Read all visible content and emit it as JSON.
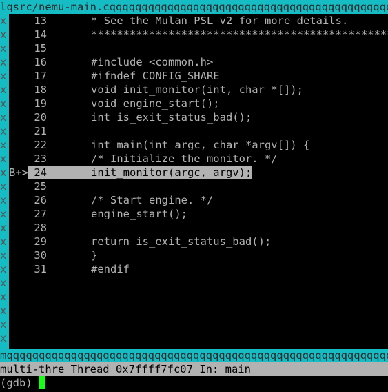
{
  "window": {
    "title_bar_text": "lqsrc/nemu-main.cqqqqqqqqqqqqqqqqqqqqqqqqqqqqqqqqqqqqqqqqqqqqqqqqqqqqqqqqqqq",
    "bottom_border_text": "mqqqqqqqqqqqqqqqqqqqqqqqqqqqqqqqqqqqqqqqqqqqqqqqqqqqqqqqqqqqqqqqqqqqqqqqq",
    "left_border_char": "x",
    "source_file": "src/nemu-main.c",
    "border_color": "#16bcc4",
    "highlight_color": "#b2b2b2",
    "background_color": "#000000",
    "text_color": "#b2b2b2",
    "cursor_color": "#16ff16"
  },
  "source": {
    "rows": [
      {
        "marker": "",
        "lineno": "13",
        "text": "* See the Mulan PSL v2 for more details.",
        "indent": 4,
        "current": false
      },
      {
        "marker": "",
        "lineno": "14",
        "text": "***************************************************",
        "indent": 4,
        "current": false
      },
      {
        "marker": "",
        "lineno": "15",
        "text": "",
        "indent": 0,
        "current": false
      },
      {
        "marker": "",
        "lineno": "16",
        "text": "#include <common.h>",
        "indent": 3,
        "current": false
      },
      {
        "marker": "",
        "lineno": "17",
        "text": "#ifndef CONFIG_SHARE",
        "indent": 3,
        "current": false
      },
      {
        "marker": "",
        "lineno": "18",
        "text": "void init_monitor(int, char *[]);",
        "indent": 3,
        "current": false
      },
      {
        "marker": "",
        "lineno": "19",
        "text": "void engine_start();",
        "indent": 3,
        "current": false
      },
      {
        "marker": "",
        "lineno": "20",
        "text": "int is_exit_status_bad();",
        "indent": 3,
        "current": false
      },
      {
        "marker": "",
        "lineno": "21",
        "text": "",
        "indent": 0,
        "current": false
      },
      {
        "marker": "",
        "lineno": "22",
        "text": "int main(int argc, char *argv[]) {",
        "indent": 3,
        "current": false
      },
      {
        "marker": "",
        "lineno": "23",
        "text": "/* Initialize the monitor. */",
        "indent": 4,
        "current": false
      },
      {
        "marker": "B+>",
        "lineno": "24",
        "text": "init_monitor(argc, argv);",
        "indent": 4,
        "current": true
      },
      {
        "marker": "",
        "lineno": "25",
        "text": "",
        "indent": 0,
        "current": false
      },
      {
        "marker": "",
        "lineno": "26",
        "text": "/* Start engine. */",
        "indent": 4,
        "current": false
      },
      {
        "marker": "",
        "lineno": "27",
        "text": "engine_start();",
        "indent": 4,
        "current": false
      },
      {
        "marker": "",
        "lineno": "28",
        "text": "",
        "indent": 0,
        "current": false
      },
      {
        "marker": "",
        "lineno": "29",
        "text": "return is_exit_status_bad();",
        "indent": 4,
        "current": false
      },
      {
        "marker": "",
        "lineno": "30",
        "text": "}",
        "indent": 3,
        "current": false
      },
      {
        "marker": "",
        "lineno": "31",
        "text": "#endif",
        "indent": 3,
        "current": false
      },
      {
        "marker": "",
        "lineno": "",
        "text": "",
        "indent": 0,
        "current": false
      },
      {
        "marker": "",
        "lineno": "",
        "text": "",
        "indent": 0,
        "current": false
      },
      {
        "marker": "",
        "lineno": "",
        "text": "",
        "indent": 0,
        "current": false
      },
      {
        "marker": "",
        "lineno": "",
        "text": "",
        "indent": 0,
        "current": false
      },
      {
        "marker": "",
        "lineno": "",
        "text": "",
        "indent": 0,
        "current": false
      }
    ]
  },
  "status": {
    "text": "multi-thre Thread 0x7ffff7fc07 In: main",
    "process": "multi-thre",
    "thread_label": "Thread",
    "thread_id": "0x7ffff7fc07",
    "in_label": "In:",
    "function": "main"
  },
  "command": {
    "prompt": "(gdb) ",
    "input_value": ""
  }
}
